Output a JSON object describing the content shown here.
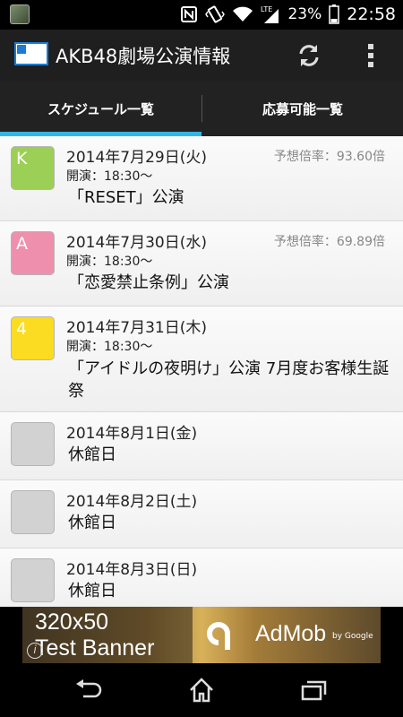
{
  "status_bar": {
    "battery_percent": "23%",
    "time": "22:58",
    "icons": [
      "app-notification-icon",
      "nfc-icon",
      "vibrate-icon",
      "wifi-icon",
      "lte-signal-icon",
      "battery-icon"
    ]
  },
  "action_bar": {
    "title": "AKB48劇場公演情報",
    "actions": [
      "refresh-icon",
      "overflow-menu-icon"
    ]
  },
  "tabs": [
    {
      "label": "スケジュール一覧",
      "selected": true
    },
    {
      "label": "応募可能一覧",
      "selected": false
    }
  ],
  "accent_color": "#33b5e5",
  "schedule": [
    {
      "badge": "K",
      "badge_color": "#9ccf55",
      "date": "2014年7月29日(火)",
      "rate": "予想倍率：93.60倍",
      "start": "開演：18:30〜",
      "title": "「RESET」公演"
    },
    {
      "badge": "A",
      "badge_color": "#ef8fae",
      "date": "2014年7月30日(水)",
      "rate": "予想倍率：69.89倍",
      "start": "開演：18:30〜",
      "title": "「恋愛禁止条例」公演"
    },
    {
      "badge": "4",
      "badge_color": "#fbdc22",
      "date": "2014年7月31日(木)",
      "rate": "",
      "start": "開演：18:30〜",
      "title": "「アイドルの夜明け」公演 7月度お客様生誕祭"
    },
    {
      "badge": "",
      "badge_color": "#d2d2d2",
      "date": "2014年8月1日(金)",
      "rate": "",
      "start": "",
      "title": "休館日"
    },
    {
      "badge": "",
      "badge_color": "#d2d2d2",
      "date": "2014年8月2日(土)",
      "rate": "",
      "start": "",
      "title": "休館日"
    },
    {
      "badge": "",
      "badge_color": "#d2d2d2",
      "date": "2014年8月3日(日)",
      "rate": "",
      "start": "",
      "title": "休館日"
    }
  ],
  "ad_banner": {
    "size_text": "320x50",
    "label": "Test Banner",
    "brand": "AdMob",
    "by_line": "by Google",
    "info_glyph": "i"
  },
  "nav_bar": {
    "icons": [
      "back-icon",
      "home-icon",
      "recent-apps-icon"
    ]
  }
}
